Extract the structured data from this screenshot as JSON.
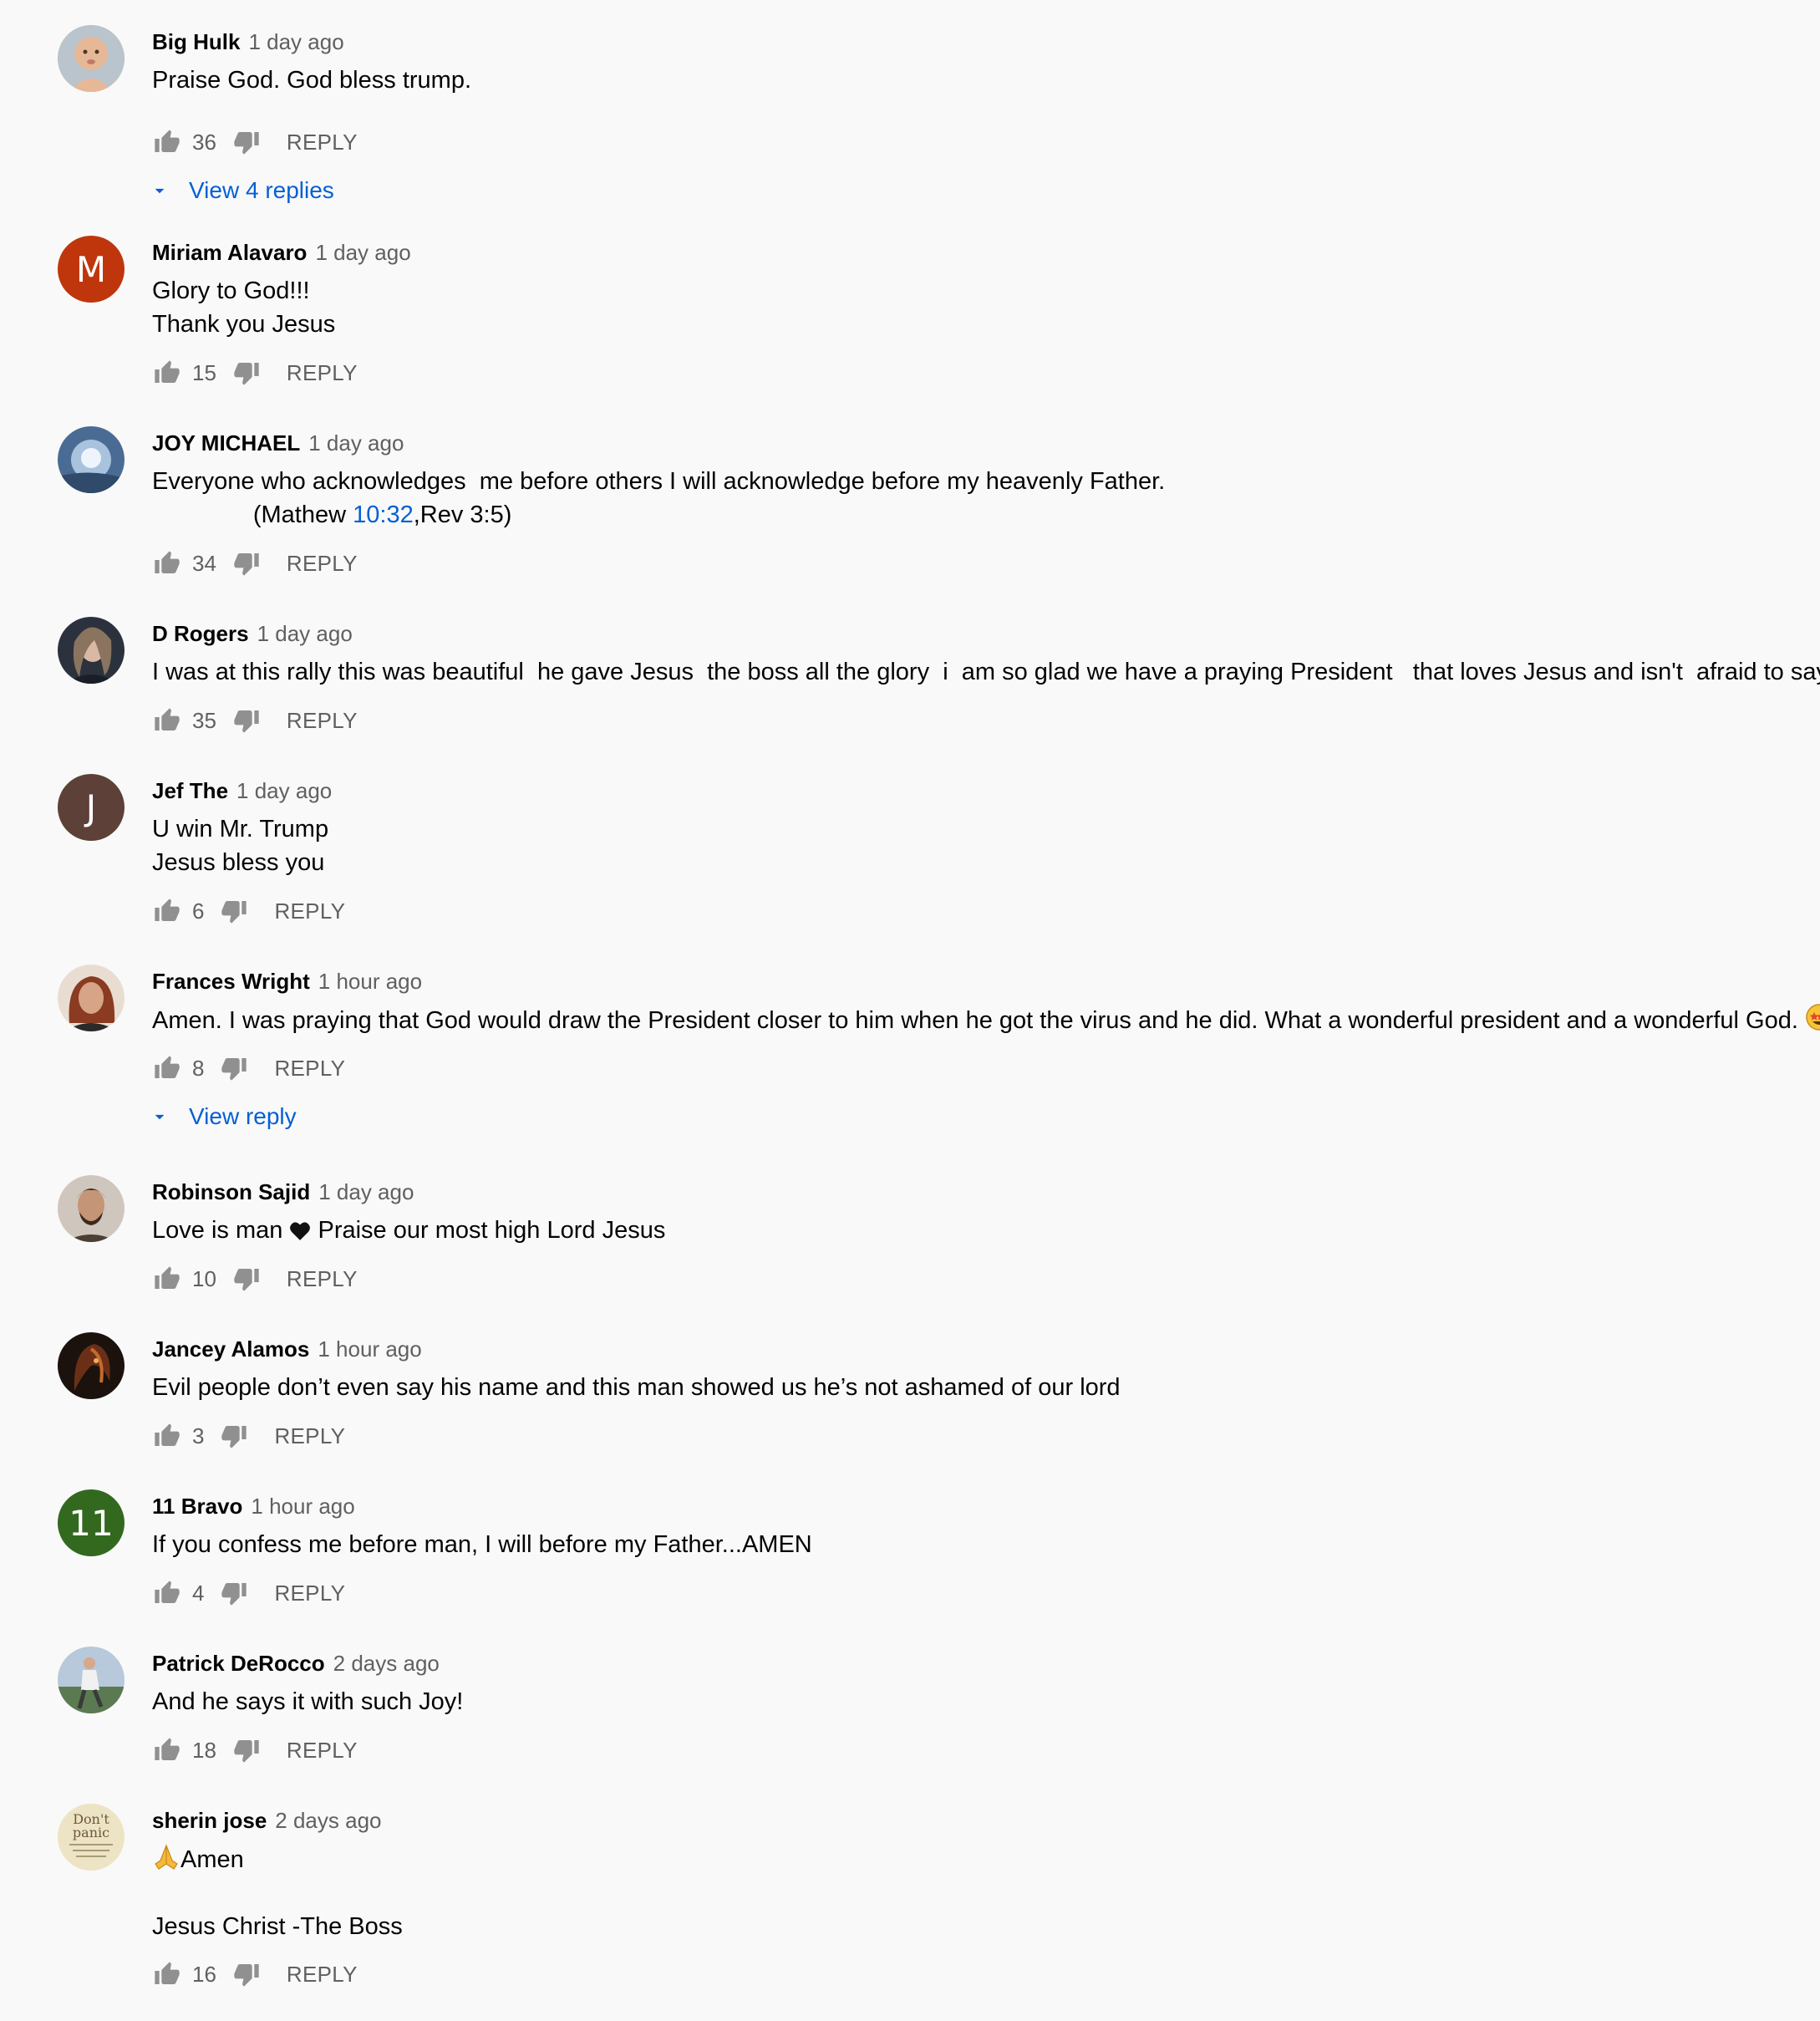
{
  "comments": [
    {
      "author": "Big Hulk",
      "time": "1 day ago",
      "lines": [
        "Praise God. God bless trump."
      ],
      "likes": "36",
      "reply": "REPLY",
      "view_replies": "View 4 replies",
      "avatar": {
        "type": "photo",
        "color": "#c9a78a"
      }
    },
    {
      "author": "Miriam Alavaro",
      "time": "1 day ago",
      "lines": [
        "Glory to God!!!",
        "Thank you Jesus"
      ],
      "likes": "15",
      "reply": "REPLY",
      "avatar": {
        "type": "letter",
        "letter": "M",
        "color": "#bf360c"
      }
    },
    {
      "author": "JOY MICHAEL",
      "time": "1 day ago",
      "lines": [
        "Everyone who acknowledges  me before others I will acknowledge before my heavenly Father."
      ],
      "verse_prefix": "               (Mathew ",
      "verse_link": "10:32",
      "verse_suffix": ",Rev 3:5)",
      "likes": "34",
      "reply": "REPLY",
      "avatar": {
        "type": "photo",
        "color": "#5a7fa6"
      }
    },
    {
      "author": "D Rogers",
      "time": "1 day ago",
      "lines": [
        "I was at this rally this was beautiful  he gave Jesus  the boss all the glory  i  am so glad we have a praying President   that loves Jesus and isn't  afraid to say so."
      ],
      "likes": "35",
      "reply": "REPLY",
      "avatar": {
        "type": "photo",
        "color": "#3d4654"
      }
    },
    {
      "author": "Jef The",
      "time": "1 day ago",
      "lines": [
        "U win Mr. Trump",
        "Jesus bless you"
      ],
      "likes": "6",
      "reply": "REPLY",
      "avatar": {
        "type": "letter",
        "letter": "J",
        "color": "#5d4037"
      }
    },
    {
      "author": "Frances Wright",
      "time": "1 hour ago",
      "lines": [
        "Amen. I was praying that God would draw the President closer to him when he got the virus and he did. What a wonderful president and a wonderful God. "
      ],
      "emoji": "star-struck-emoji",
      "likes": "8",
      "reply": "REPLY",
      "view_replies": "View reply",
      "avatar": {
        "type": "photo",
        "color": "#8a3b2a"
      }
    },
    {
      "author": "Robinson Sajid",
      "time": "1 day ago",
      "lines_pre": "Love is man ",
      "lines_post": " Praise our most high Lord Jesus",
      "likes": "10",
      "reply": "REPLY",
      "avatar": {
        "type": "photo",
        "color": "#6b5848"
      }
    },
    {
      "author": "Jancey Alamos",
      "time": "1 hour ago",
      "lines": [
        "Evil people don’t even say his name and this man showed us he’s not ashamed of our lord"
      ],
      "likes": "3",
      "reply": "REPLY",
      "avatar": {
        "type": "photo",
        "color": "#2a1d16"
      }
    },
    {
      "author": "11 Bravo",
      "time": "1 hour ago",
      "lines": [
        "If you confess me before man, I will before my Father...AMEN"
      ],
      "likes": "4",
      "reply": "REPLY",
      "avatar": {
        "type": "letter",
        "letter": "11",
        "color": "#33691e"
      }
    },
    {
      "author": "Patrick DeRocco",
      "time": "2 days ago",
      "lines": [
        "And he says it with such Joy!"
      ],
      "likes": "18",
      "reply": "REPLY",
      "avatar": {
        "type": "photo",
        "color": "#7d95b0"
      }
    },
    {
      "author": "sherin jose",
      "time": "2 days ago",
      "lines": [
        "Amen",
        "",
        "Jesus Christ -The Boss"
      ],
      "likes": "16",
      "reply": "REPLY",
      "avatar": {
        "type": "photo",
        "color": "#ece4c4",
        "text": "Don't panic"
      }
    }
  ],
  "colors": {
    "link": "#065fd4",
    "secondary": "#606060",
    "icon": "#909090",
    "background": "#f9f9f9"
  }
}
